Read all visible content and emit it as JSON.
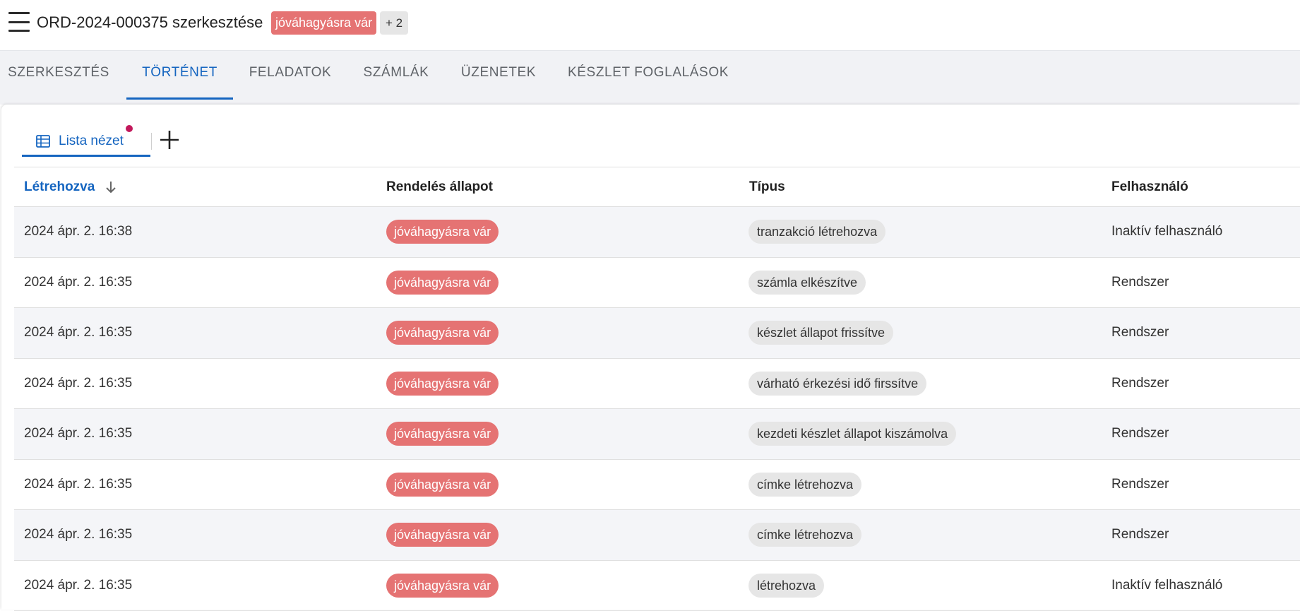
{
  "header": {
    "title": "ORD-2024-000375 szerkesztése",
    "status_badge": "jóváhagyásra vár",
    "more_badge": "+ 2"
  },
  "tabs": [
    {
      "label": "SZERKESZTÉS"
    },
    {
      "label": "TÖRTÉNET"
    },
    {
      "label": "FELADATOK"
    },
    {
      "label": "SZÁMLÁK"
    },
    {
      "label": "ÜZENETEK"
    },
    {
      "label": "KÉSZLET FOGLALÁSOK"
    }
  ],
  "active_tab": "TÖRTÉNET",
  "view": {
    "label": "Lista nézet"
  },
  "table": {
    "columns": [
      "Létrehozva",
      "Rendelés állapot",
      "Típus",
      "Felhasználó"
    ],
    "sorted_column": "Létrehozva",
    "sort_direction": "descending",
    "rows": [
      {
        "created": "2024 ápr. 2. 16:38",
        "status": "jóváhagyásra vár",
        "type": "tranzakció létrehozva",
        "user": "Inaktív felhasználó"
      },
      {
        "created": "2024 ápr. 2. 16:35",
        "status": "jóváhagyásra vár",
        "type": "számla elkészítve",
        "user": "Rendszer"
      },
      {
        "created": "2024 ápr. 2. 16:35",
        "status": "jóváhagyásra vár",
        "type": "készlet állapot frissítve",
        "user": "Rendszer"
      },
      {
        "created": "2024 ápr. 2. 16:35",
        "status": "jóváhagyásra vár",
        "type": "várható érkezési idő firssítve",
        "user": "Rendszer"
      },
      {
        "created": "2024 ápr. 2. 16:35",
        "status": "jóváhagyásra vár",
        "type": "kezdeti készlet állapot kiszámolva",
        "user": "Rendszer"
      },
      {
        "created": "2024 ápr. 2. 16:35",
        "status": "jóváhagyásra vár",
        "type": "címke létrehozva",
        "user": "Rendszer"
      },
      {
        "created": "2024 ápr. 2. 16:35",
        "status": "jóváhagyásra vár",
        "type": "címke létrehozva",
        "user": "Rendszer"
      },
      {
        "created": "2024 ápr. 2. 16:35",
        "status": "jóváhagyásra vár",
        "type": "létrehozva",
        "user": "Inaktív felhasználó"
      }
    ]
  },
  "colors": {
    "accent": "#1565c0",
    "status_badge": "#e57373",
    "notification_dot": "#c2185b",
    "chip_gray": "#e6e6e6",
    "row_alt": "#f4f5f8"
  },
  "icons": {
    "menu": "hamburger-menu-icon",
    "view": "table-icon",
    "add": "plus-icon",
    "sort": "arrow-down-icon"
  }
}
